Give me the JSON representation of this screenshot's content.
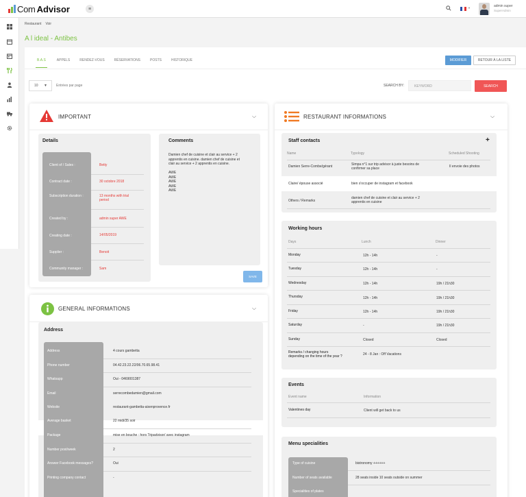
{
  "app": {
    "logo_prefix": "Com",
    "logo_name": "Advisor"
  },
  "colors": {
    "accent": "#7cc243",
    "danger": "#e53935",
    "primary": "#5b9bd5",
    "search_button": "#f05656",
    "label_column": "#a8a8a8"
  },
  "header": {
    "user_name": "admin super",
    "user_role": "SuperAdmin",
    "search_icon": "search-icon",
    "flag": "france-flag"
  },
  "sidebar": {
    "items": [
      {
        "icon": "dashboard-icon"
      },
      {
        "icon": "calendar-icon"
      },
      {
        "icon": "calendar-icon"
      },
      {
        "icon": "restaurant-icon"
      },
      {
        "icon": "users-icon"
      },
      {
        "icon": "chart-icon"
      },
      {
        "icon": "truck-icon"
      },
      {
        "icon": "settings-icon"
      }
    ]
  },
  "breadcrumb": [
    "Restaurant",
    "Voir"
  ],
  "page_title": "A l ideal - Antibes",
  "tabs": [
    "B.A.S",
    "APPELS",
    "RENDEZ-VOUS",
    "RÉSERVATIONS",
    "POSTS",
    "HISTORIQUE"
  ],
  "actions": {
    "modify": "MODIFIER",
    "back": "RETOUR À LA LISTE"
  },
  "filters": {
    "length_value": "10",
    "length_label": "Entrées par page",
    "search_label": "SEARCH BY:",
    "search_placeholder": "KEYWORD",
    "search_button": "SEARCH"
  },
  "important": {
    "title": "IMPORTANT",
    "details_title": "Details",
    "details": [
      {
        "label": "Client of / Sales :",
        "value": "Betty"
      },
      {
        "label": "Contract date :",
        "value": "30 octobre 2018"
      },
      {
        "label": "Subscription duration :",
        "value": "13 months with trial period"
      },
      {
        "label": "Created by :",
        "value": "admin super AWE"
      },
      {
        "label": "Creating date :",
        "value": "14/05/2019"
      },
      {
        "label": "Supplier :",
        "value": "Benoit"
      },
      {
        "label": "Community manager :",
        "value": "Sam"
      }
    ],
    "comments_title": "Comments",
    "comments_lines": [
      "Damien chef de cuisine et clair au service + 2",
      "apprentis en cuisine. damien chef de cuisine et",
      "clair au service + 2 apprentis en cuisine.",
      "",
      "AWE",
      "AWE",
      "AWE",
      "AWE",
      "AWE"
    ],
    "save_label": "SAVE"
  },
  "general": {
    "title": "GENERAL INFORMATIONS",
    "address_title": "Address",
    "rows": [
      {
        "label": "Address",
        "value": "4 cours gambetta"
      },
      {
        "label": "Phone number",
        "value": "04.42.23.22.22/06.70.65.98.41"
      },
      {
        "label": "Whatsapp",
        "value": "Oui - 0469001387"
      },
      {
        "label": "Email",
        "value": "serrecombedamien@gmail.com"
      },
      {
        "label": "Website",
        "value": "restaurant-gambetta-aixenprovence.fr"
      },
      {
        "label": "Average basket",
        "value": "22 midi/35 soir"
      },
      {
        "label": "Package",
        "value": "mise en bouche : hors Tripadvisor/ avec instagram"
      },
      {
        "label": "Number post/week",
        "value": "2"
      },
      {
        "label": "Answer Facebook messages?",
        "value": "Oui"
      },
      {
        "label": "Printing company contact",
        "value": "-"
      }
    ]
  },
  "restaurant": {
    "title": "RESTAURANT INFORMATIONS",
    "staff": {
      "title": "Staff contacts",
      "headers": [
        "Name",
        "Typology",
        "Scheduled Shooting"
      ],
      "rows": [
        {
          "name": "Damien Serre-Combe/gérant",
          "typology": "Simpa n°1 sur trip advisor à juste besoins de confirmer sa place",
          "typology_lines": [
            "Simpa n°1 sur trip advisor à juste besoins de",
            "confirmer sa place"
          ],
          "shooting": "Il envoie des photos"
        },
        {
          "name": "Claire/ épouse associé",
          "typology": "bien s'occuper de instagram et facebook",
          "typology_lines": [
            "bien s'occuper de instagram et facebook"
          ],
          "shooting": ""
        },
        {
          "name": "Others / Remarks",
          "typology": "damien chef de cuisine et clair au service + 2 apprentis en cuisine",
          "typology_lines": [
            "damien chef de cuisine et clair au service + 2",
            "apprentis en cuisine"
          ],
          "shooting": ""
        }
      ]
    },
    "hours": {
      "title": "Working hours",
      "headers": [
        "Days",
        "Lunch",
        "Dinner"
      ],
      "rows": [
        {
          "day": "Monday",
          "lunch": "12h - 14h",
          "dinner": "-"
        },
        {
          "day": "Tuesday",
          "lunch": "12h - 14h",
          "dinner": "-"
        },
        {
          "day": "Wednesday",
          "lunch": "12h - 14h",
          "dinner": "19h / 21h30"
        },
        {
          "day": "Thursday",
          "lunch": "12h - 14h",
          "dinner": "19h / 21h30"
        },
        {
          "day": "Friday",
          "lunch": "12h - 14h",
          "dinner": "19h / 21h30"
        },
        {
          "day": "Saturday",
          "lunch": "-",
          "dinner": "19h / 21h30"
        },
        {
          "day": "Sunday",
          "lunch": "Closed",
          "dinner": "Closed"
        }
      ],
      "remarks_label_lines": [
        "Remarks / changing hours",
        "depending on the time of the year ?"
      ],
      "remarks_value": "24 - 8 Jan : Off Vacations"
    },
    "events": {
      "title": "Events",
      "headers": [
        "Event name",
        "Information"
      ],
      "rows": [
        {
          "name": "Valentines day",
          "info": "Client will get back to us"
        }
      ]
    },
    "menu": {
      "title": "Menu specialities",
      "rows": [
        {
          "label": "Type of cuisine",
          "value": "bistronomy ++++++"
        },
        {
          "label": "Number of seats available",
          "value": "28 seats inside 10 seats outside on summer"
        },
        {
          "label": "Specialities of plates",
          "value": ""
        }
      ]
    }
  }
}
